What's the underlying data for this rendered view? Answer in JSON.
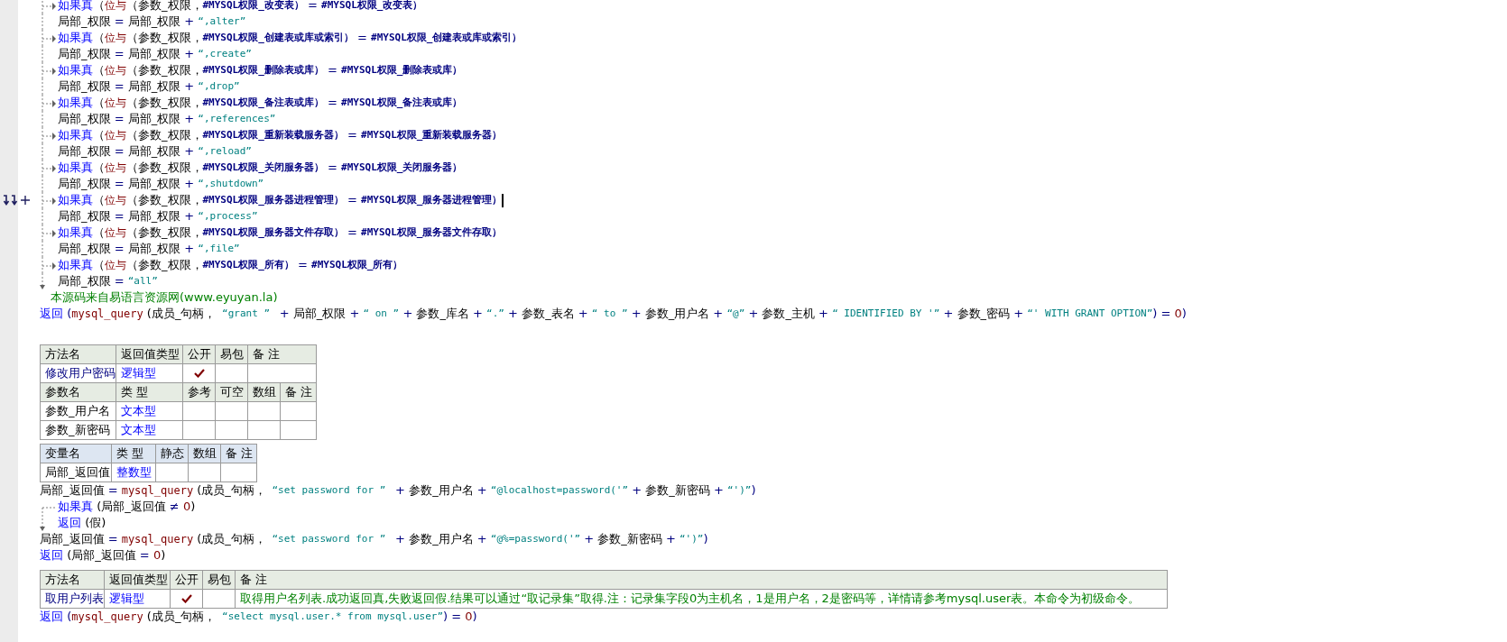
{
  "blocks": [
    {
      "kind": "code",
      "lines": [
        {
          "kind": "if",
          "arrow": true,
          "tokens": [
            {
              "kind": "kw",
              "text": "如果真"
            },
            {
              "kind": "id",
              "text": "（"
            },
            {
              "kind": "fn",
              "text": "位与"
            },
            {
              "kind": "id",
              "text": "（参数_权限，"
            },
            {
              "kind": "const",
              "text": "#MYSQL权限_改变表）"
            },
            {
              "kind": "op",
              "text": " = "
            },
            {
              "kind": "const",
              "text": "#MYSQL权限_改变表）"
            }
          ]
        },
        {
          "kind": "body",
          "tokens": [
            {
              "kind": "id",
              "text": "局部_权限"
            },
            {
              "kind": "op",
              "text": " = "
            },
            {
              "kind": "id",
              "text": "局部_权限"
            },
            {
              "kind": "op",
              "text": " + "
            },
            {
              "kind": "str",
              "text": "“,alter”"
            }
          ]
        },
        {
          "kind": "if",
          "arrow": true,
          "tokens": [
            {
              "kind": "kw",
              "text": "如果真"
            },
            {
              "kind": "id",
              "text": "（"
            },
            {
              "kind": "fn",
              "text": "位与"
            },
            {
              "kind": "id",
              "text": "（参数_权限，"
            },
            {
              "kind": "const",
              "text": "#MYSQL权限_创建表或库或索引）"
            },
            {
              "kind": "op",
              "text": " = "
            },
            {
              "kind": "const",
              "text": "#MYSQL权限_创建表或库或索引）"
            }
          ]
        },
        {
          "kind": "body",
          "tokens": [
            {
              "kind": "id",
              "text": "局部_权限"
            },
            {
              "kind": "op",
              "text": " = "
            },
            {
              "kind": "id",
              "text": "局部_权限"
            },
            {
              "kind": "op",
              "text": " + "
            },
            {
              "kind": "str",
              "text": "“,create”"
            }
          ]
        },
        {
          "kind": "if",
          "arrow": true,
          "tokens": [
            {
              "kind": "kw",
              "text": "如果真"
            },
            {
              "kind": "id",
              "text": "（"
            },
            {
              "kind": "fn",
              "text": "位与"
            },
            {
              "kind": "id",
              "text": "（参数_权限，"
            },
            {
              "kind": "const",
              "text": "#MYSQL权限_删除表或库）"
            },
            {
              "kind": "op",
              "text": " = "
            },
            {
              "kind": "const",
              "text": "#MYSQL权限_删除表或库）"
            }
          ]
        },
        {
          "kind": "body",
          "tokens": [
            {
              "kind": "id",
              "text": "局部_权限"
            },
            {
              "kind": "op",
              "text": " = "
            },
            {
              "kind": "id",
              "text": "局部_权限"
            },
            {
              "kind": "op",
              "text": " + "
            },
            {
              "kind": "str",
              "text": "“,drop”"
            }
          ]
        },
        {
          "kind": "if",
          "arrow": true,
          "tokens": [
            {
              "kind": "kw",
              "text": "如果真"
            },
            {
              "kind": "id",
              "text": "（"
            },
            {
              "kind": "fn",
              "text": "位与"
            },
            {
              "kind": "id",
              "text": "（参数_权限，"
            },
            {
              "kind": "const",
              "text": "#MYSQL权限_备注表或库）"
            },
            {
              "kind": "op",
              "text": " = "
            },
            {
              "kind": "const",
              "text": "#MYSQL权限_备注表或库）"
            }
          ]
        },
        {
          "kind": "body",
          "tokens": [
            {
              "kind": "id",
              "text": "局部_权限"
            },
            {
              "kind": "op",
              "text": " = "
            },
            {
              "kind": "id",
              "text": "局部_权限"
            },
            {
              "kind": "op",
              "text": " + "
            },
            {
              "kind": "str",
              "text": "“,references”"
            }
          ]
        },
        {
          "kind": "if",
          "arrow": true,
          "tokens": [
            {
              "kind": "kw",
              "text": "如果真"
            },
            {
              "kind": "id",
              "text": "（"
            },
            {
              "kind": "fn",
              "text": "位与"
            },
            {
              "kind": "id",
              "text": "（参数_权限，"
            },
            {
              "kind": "const",
              "text": "#MYSQL权限_重新装载服务器）"
            },
            {
              "kind": "op",
              "text": " = "
            },
            {
              "kind": "const",
              "text": "#MYSQL权限_重新装载服务器）"
            }
          ]
        },
        {
          "kind": "body",
          "tokens": [
            {
              "kind": "id",
              "text": "局部_权限"
            },
            {
              "kind": "op",
              "text": " = "
            },
            {
              "kind": "id",
              "text": "局部_权限"
            },
            {
              "kind": "op",
              "text": " + "
            },
            {
              "kind": "str",
              "text": "“,reload”"
            }
          ]
        },
        {
          "kind": "if",
          "arrow": true,
          "tokens": [
            {
              "kind": "kw",
              "text": "如果真"
            },
            {
              "kind": "id",
              "text": "（"
            },
            {
              "kind": "fn",
              "text": "位与"
            },
            {
              "kind": "id",
              "text": "（参数_权限，"
            },
            {
              "kind": "const",
              "text": "#MYSQL权限_关闭服务器）"
            },
            {
              "kind": "op",
              "text": " = "
            },
            {
              "kind": "const",
              "text": "#MYSQL权限_关闭服务器）"
            }
          ]
        },
        {
          "kind": "body",
          "tokens": [
            {
              "kind": "id",
              "text": "局部_权限"
            },
            {
              "kind": "op",
              "text": " = "
            },
            {
              "kind": "id",
              "text": "局部_权限"
            },
            {
              "kind": "op",
              "text": " + "
            },
            {
              "kind": "str",
              "text": "“,shutdown”"
            }
          ]
        },
        {
          "kind": "if",
          "arrow": true,
          "marker": true,
          "cursor": true,
          "tokens": [
            {
              "kind": "kw",
              "text": "如果真"
            },
            {
              "kind": "id",
              "text": "（"
            },
            {
              "kind": "fn",
              "text": "位与"
            },
            {
              "kind": "id",
              "text": "（参数_权限，"
            },
            {
              "kind": "const",
              "text": "#MYSQL权限_服务器进程管理）"
            },
            {
              "kind": "op",
              "text": " = "
            },
            {
              "kind": "const",
              "text": "#MYSQL权限_服务器进程管理）"
            }
          ]
        },
        {
          "kind": "body",
          "tokens": [
            {
              "kind": "id",
              "text": "局部_权限"
            },
            {
              "kind": "op",
              "text": " = "
            },
            {
              "kind": "id",
              "text": "局部_权限"
            },
            {
              "kind": "op",
              "text": " + "
            },
            {
              "kind": "str",
              "text": "“,process”"
            }
          ]
        },
        {
          "kind": "if",
          "arrow": true,
          "tokens": [
            {
              "kind": "kw",
              "text": "如果真"
            },
            {
              "kind": "id",
              "text": "（"
            },
            {
              "kind": "fn",
              "text": "位与"
            },
            {
              "kind": "id",
              "text": "（参数_权限，"
            },
            {
              "kind": "const",
              "text": "#MYSQL权限_服务器文件存取）"
            },
            {
              "kind": "op",
              "text": " = "
            },
            {
              "kind": "const",
              "text": "#MYSQL权限_服务器文件存取）"
            }
          ]
        },
        {
          "kind": "body",
          "tokens": [
            {
              "kind": "id",
              "text": "局部_权限"
            },
            {
              "kind": "op",
              "text": " = "
            },
            {
              "kind": "id",
              "text": "局部_权限"
            },
            {
              "kind": "op",
              "text": " + "
            },
            {
              "kind": "str",
              "text": "“,file”"
            }
          ]
        },
        {
          "kind": "if",
          "arrow": true,
          "tokens": [
            {
              "kind": "kw",
              "text": "如果真"
            },
            {
              "kind": "id",
              "text": "（"
            },
            {
              "kind": "fn",
              "text": "位与"
            },
            {
              "kind": "id",
              "text": "（参数_权限，"
            },
            {
              "kind": "const",
              "text": "#MYSQL权限_所有）"
            },
            {
              "kind": "op",
              "text": " = "
            },
            {
              "kind": "const",
              "text": "#MYSQL权限_所有）"
            }
          ]
        },
        {
          "kind": "body",
          "last": true,
          "tokens": [
            {
              "kind": "id",
              "text": "局部_权限"
            },
            {
              "kind": "op",
              "text": " = "
            },
            {
              "kind": "str",
              "text": "“all”"
            }
          ]
        },
        {
          "kind": "comment",
          "tokens": [
            {
              "kind": "cm",
              "text": "本源码来自易语言资源网(www.eyuyan.la)"
            }
          ]
        },
        {
          "kind": "plain",
          "tokens": [
            {
              "kind": "kw",
              "text": "返回"
            },
            {
              "kind": "op",
              "text": " ("
            },
            {
              "kind": "fn",
              "text": "mysql_query"
            },
            {
              "kind": "id",
              "text": " (成员_句柄，"
            },
            {
              "kind": "str",
              "text": " “grant ” "
            },
            {
              "kind": "op",
              "text": " + "
            },
            {
              "kind": "id",
              "text": "局部_权限"
            },
            {
              "kind": "op",
              "text": " + "
            },
            {
              "kind": "str",
              "text": "“ on ”"
            },
            {
              "kind": "op",
              "text": " + "
            },
            {
              "kind": "id",
              "text": "参数_库名"
            },
            {
              "kind": "op",
              "text": " + "
            },
            {
              "kind": "str",
              "text": "“.”"
            },
            {
              "kind": "op",
              "text": " + "
            },
            {
              "kind": "id",
              "text": "参数_表名"
            },
            {
              "kind": "op",
              "text": " + "
            },
            {
              "kind": "str",
              "text": "“ to ”"
            },
            {
              "kind": "op",
              "text": " + "
            },
            {
              "kind": "id",
              "text": "参数_用户名"
            },
            {
              "kind": "op",
              "text": " + "
            },
            {
              "kind": "str",
              "text": "“@”"
            },
            {
              "kind": "op",
              "text": " + "
            },
            {
              "kind": "id",
              "text": "参数_主机"
            },
            {
              "kind": "op",
              "text": " + "
            },
            {
              "kind": "str",
              "text": "“ IDENTIFIED BY '”"
            },
            {
              "kind": "op",
              "text": " + "
            },
            {
              "kind": "id",
              "text": "参数_密码"
            },
            {
              "kind": "op",
              "text": " + "
            },
            {
              "kind": "str",
              "text": "“' WITH GRANT OPTION”"
            },
            {
              "kind": "op",
              "text": ") = "
            },
            {
              "kind": "num",
              "text": "0"
            },
            {
              "kind": "op",
              "text": ")"
            }
          ]
        },
        {
          "kind": "blank"
        }
      ]
    },
    {
      "kind": "method_table",
      "columns": [
        "方法名",
        "返回值类型",
        "公开",
        "易包",
        "备 注"
      ],
      "method": {
        "name": "修改用户密码",
        "type": "逻辑型",
        "public": true
      },
      "param_columns": [
        "参数名",
        "类 型",
        "参考",
        "可空",
        "数组",
        "备 注"
      ],
      "params": [
        {
          "name": "参数_用户名",
          "type": "文本型"
        },
        {
          "name": "参数_新密码",
          "type": "文本型"
        }
      ]
    },
    {
      "kind": "var_table",
      "columns": [
        "变量名",
        "类 型",
        "静态",
        "数组",
        "备 注"
      ],
      "vars": [
        {
          "name": "局部_返回值",
          "type": "整数型"
        }
      ]
    },
    {
      "kind": "code",
      "lines": [
        {
          "kind": "plain",
          "tokens": [
            {
              "kind": "id",
              "text": "局部_返回值"
            },
            {
              "kind": "op",
              "text": " = "
            },
            {
              "kind": "fn",
              "text": "mysql_query"
            },
            {
              "kind": "id",
              "text": " (成员_句柄，"
            },
            {
              "kind": "str",
              "text": " “set password for ” "
            },
            {
              "kind": "op",
              "text": " + "
            },
            {
              "kind": "id",
              "text": "参数_用户名"
            },
            {
              "kind": "op",
              "text": " + "
            },
            {
              "kind": "str",
              "text": "“@localhost=password('”"
            },
            {
              "kind": "op",
              "text": " + "
            },
            {
              "kind": "id",
              "text": "参数_新密码"
            },
            {
              "kind": "op",
              "text": " + "
            },
            {
              "kind": "str",
              "text": "“')”"
            },
            {
              "kind": "op",
              "text": ")"
            }
          ]
        },
        {
          "kind": "if",
          "arrow": false,
          "opens": true,
          "tokens": [
            {
              "kind": "kw",
              "text": "如果真"
            },
            {
              "kind": "id",
              "text": " (局部_返回值 "
            },
            {
              "kind": "op",
              "text": "≠ "
            },
            {
              "kind": "num",
              "text": "0"
            },
            {
              "kind": "id",
              "text": ")"
            }
          ]
        },
        {
          "kind": "body",
          "last": true,
          "tokens": [
            {
              "kind": "kw",
              "text": "返回"
            },
            {
              "kind": "id",
              "text": " (假)"
            }
          ]
        },
        {
          "kind": "plain",
          "tokens": [
            {
              "kind": "id",
              "text": "局部_返回值"
            },
            {
              "kind": "op",
              "text": " = "
            },
            {
              "kind": "fn",
              "text": "mysql_query"
            },
            {
              "kind": "id",
              "text": " (成员_句柄，"
            },
            {
              "kind": "str",
              "text": " “set password for ” "
            },
            {
              "kind": "op",
              "text": " + "
            },
            {
              "kind": "id",
              "text": "参数_用户名"
            },
            {
              "kind": "op",
              "text": " + "
            },
            {
              "kind": "str",
              "text": "“@%=password('”"
            },
            {
              "kind": "op",
              "text": " + "
            },
            {
              "kind": "id",
              "text": "参数_新密码"
            },
            {
              "kind": "op",
              "text": " + "
            },
            {
              "kind": "str",
              "text": "“')”"
            },
            {
              "kind": "op",
              "text": ")"
            }
          ]
        },
        {
          "kind": "plain",
          "tokens": [
            {
              "kind": "kw",
              "text": "返回"
            },
            {
              "kind": "id",
              "text": " (局部_返回值 "
            },
            {
              "kind": "op",
              "text": "= "
            },
            {
              "kind": "num",
              "text": "0"
            },
            {
              "kind": "id",
              "text": ")"
            }
          ]
        }
      ]
    },
    {
      "kind": "method_table",
      "columns": [
        "方法名",
        "返回值类型",
        "公开",
        "易包",
        "备 注"
      ],
      "method": {
        "name": "取用户列表",
        "type": "逻辑型",
        "public": true,
        "note": "取得用户名列表.成功返回真,失败返回假.结果可以通过“取记录集”取得.注：记录集字段0为主机名，1是用户名，2是密码等，详情请参考mysql.user表。本命令为初级命令。"
      }
    },
    {
      "kind": "code",
      "lines": [
        {
          "kind": "plain",
          "tokens": [
            {
              "kind": "kw",
              "text": "返回"
            },
            {
              "kind": "op",
              "text": " ("
            },
            {
              "kind": "fn",
              "text": "mysql_query"
            },
            {
              "kind": "id",
              "text": " (成员_句柄，"
            },
            {
              "kind": "str",
              "text": " “select mysql.user.* from mysql.user”"
            },
            {
              "kind": "op",
              "text": ") = "
            },
            {
              "kind": "num",
              "text": "0"
            },
            {
              "kind": "op",
              "text": ")"
            }
          ]
        }
      ]
    }
  ]
}
